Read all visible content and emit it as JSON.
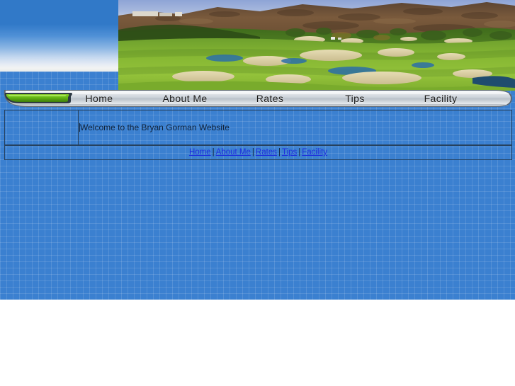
{
  "site": {
    "title": "Bryan Gorman Website"
  },
  "header": {
    "banner_alt": "golf-course-banner"
  },
  "nav": {
    "logo_name": "green-tab-logo",
    "items": [
      {
        "label": "Home",
        "name": "nav-item-home"
      },
      {
        "label": "About Me",
        "name": "nav-item-about-me"
      },
      {
        "label": "Rates",
        "name": "nav-item-rates"
      },
      {
        "label": "Tips",
        "name": "nav-item-tips"
      },
      {
        "label": "Facility",
        "name": "nav-item-facility"
      }
    ]
  },
  "content": {
    "welcome_text": "Welcome to the Bryan Gorman Website",
    "side_cell_text": ""
  },
  "footer": {
    "links": [
      {
        "label": "Home"
      },
      {
        "label": "About Me"
      },
      {
        "label": "Rates"
      },
      {
        "label": "Tips"
      },
      {
        "label": "Facility"
      }
    ],
    "separator": "|"
  },
  "colors": {
    "page_blue": "#3b80d0",
    "link_blue": "#1f2fdd",
    "border_navy": "#26415e",
    "nav_silver": "#c9ced4",
    "logo_green": "#5ebe18"
  }
}
